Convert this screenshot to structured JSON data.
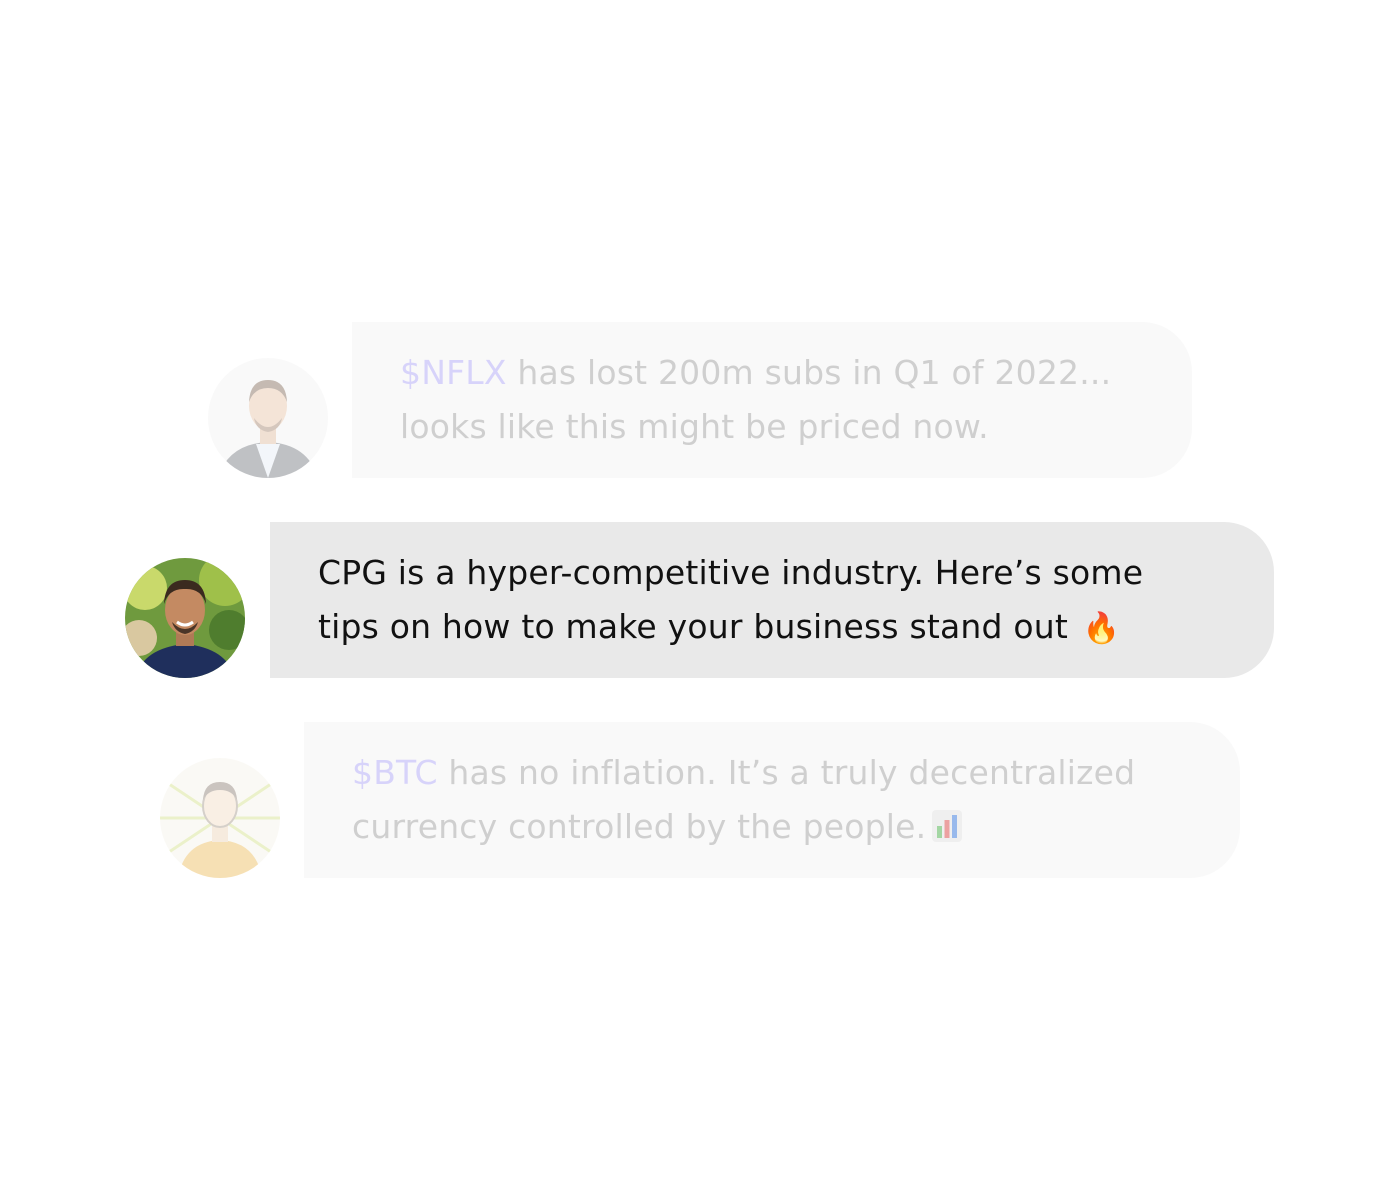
{
  "messages": [
    {
      "ticker": "$NFLX",
      "line1_rest": " has lost 200m subs in Q1 of 2022...",
      "line2": "looks like this might be priced now.",
      "state": "faded"
    },
    {
      "line1": "CPG is a hyper-competitive industry. Here’s some",
      "line2": "tips on how to make your business stand out",
      "emoji": "🔥",
      "emoji_name": "fire-icon",
      "state": "active"
    },
    {
      "ticker": "$BTC",
      "line1_rest": " has no inflation. It’s a truly decentralized",
      "line2": "currency controlled by the people.",
      "emoji_name": "bar-chart-icon",
      "state": "faded"
    }
  ],
  "colors": {
    "faded_bubble": "#f9f9f9",
    "active_bubble": "#e9e9e9",
    "ticker": "#d7d3fa",
    "faded_text": "#cfcfcf",
    "active_text": "#111111"
  }
}
